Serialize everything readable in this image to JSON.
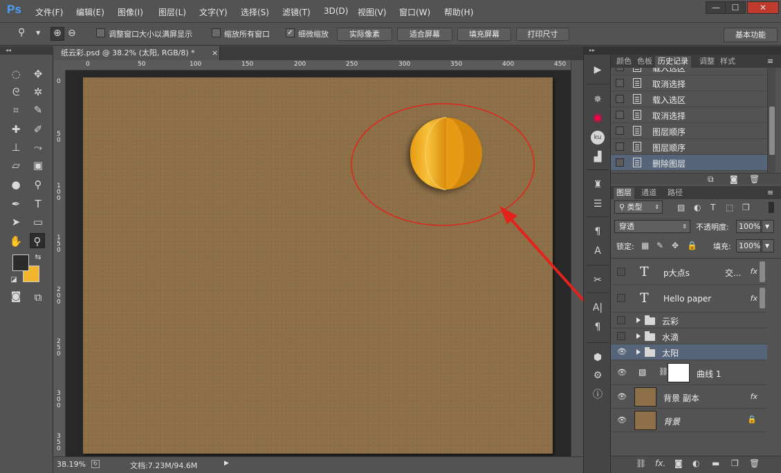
{
  "app": {
    "logo": "Ps"
  },
  "menu": [
    "文件(F)",
    "编辑(E)",
    "图像(I)",
    "图层(L)",
    "文字(Y)",
    "选择(S)",
    "滤镜(T)",
    "3D(D)",
    "视图(V)",
    "窗口(W)",
    "帮助(H)"
  ],
  "window_buttons": {
    "minimize": "—",
    "maximize": "☐",
    "close": "✕"
  },
  "options": {
    "fit_window_label": "调整窗口大小以满屏显示",
    "fit_window_checked": false,
    "zoom_all_label": "缩放所有窗口",
    "zoom_all_checked": false,
    "scrubby_label": "细微缩放",
    "scrubby_checked": true,
    "buttons": [
      "实际像素",
      "适合屏幕",
      "填充屏幕",
      "打印尺寸"
    ],
    "workspace": "基本功能"
  },
  "document": {
    "tab_title": "纸云彩.psd @ 38.2% (太阳, RGB/8) *",
    "tab_close": "×",
    "ruler_top": [
      "0",
      "50",
      "100",
      "150",
      "200",
      "250",
      "300",
      "350",
      "400",
      "450"
    ],
    "ruler_left": [
      "0",
      "50",
      "100",
      "150",
      "200",
      "250",
      "300",
      "350"
    ],
    "canvas_color": "#8d7048"
  },
  "status": {
    "zoom": "38.19%",
    "doc_info": "文档:7.23M/94.6M"
  },
  "history_panel": {
    "tabs": [
      "颜色",
      "色板",
      "历史记录",
      "调整",
      "样式"
    ],
    "active_tab": "历史记录",
    "items": [
      "载入选区",
      "取消选择",
      "载入选区",
      "取消选择",
      "图层顺序",
      "图层顺序",
      "删除图层"
    ],
    "selected_index": 6
  },
  "layers_panel": {
    "tabs": [
      "图层",
      "通道",
      "路径"
    ],
    "active_tab": "图层",
    "filter_kind": "类型",
    "blend_mode": "穿透",
    "opacity_label": "不透明度:",
    "opacity_value": "100%",
    "lock_label": "锁定:",
    "fill_label": "填充:",
    "fill_value": "100%",
    "layers": [
      {
        "name": "p大点s",
        "kind": "text",
        "extra": "交...",
        "fx": "fx",
        "visible": false
      },
      {
        "name": "Hello paper",
        "kind": "text",
        "fx": "fx",
        "visible": false
      },
      {
        "name": "云彩",
        "kind": "group",
        "visible": false
      },
      {
        "name": "水滴",
        "kind": "group",
        "visible": false
      },
      {
        "name": "太阳",
        "kind": "group",
        "visible": true,
        "selected": true
      },
      {
        "name": "曲线 1",
        "kind": "adjustment",
        "visible": true
      },
      {
        "name": "背景 副本",
        "kind": "pixel",
        "fx": "fx",
        "visible": true
      },
      {
        "name": "背景",
        "kind": "background",
        "visible": true,
        "locked": true
      }
    ]
  },
  "colors": {
    "foreground": "#2b2b2b",
    "background": "#f1b52e",
    "selection_highlight": "#56657a",
    "annotation": "#e3221c",
    "sun": "#f0a91c"
  }
}
